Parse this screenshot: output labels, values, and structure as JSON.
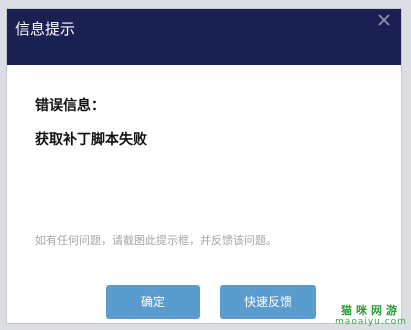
{
  "dialog": {
    "title": "信息提示",
    "close_icon": "close-icon",
    "error_label": "错误信息：",
    "error_message": "获取补丁脚本失败",
    "hint": "如有任何问题，请截图此提示框，并反馈该问题。",
    "buttons": {
      "ok_label": "确定",
      "feedback_label": "快速反馈"
    }
  },
  "watermark": {
    "text_cn": "猫咪网游",
    "text_en": "maoaiyu.com"
  },
  "colors": {
    "titlebar": "#1a2152",
    "button": "#5b9ccf",
    "hint_text": "#a6a6a6",
    "watermark": "#2e9b3c"
  }
}
